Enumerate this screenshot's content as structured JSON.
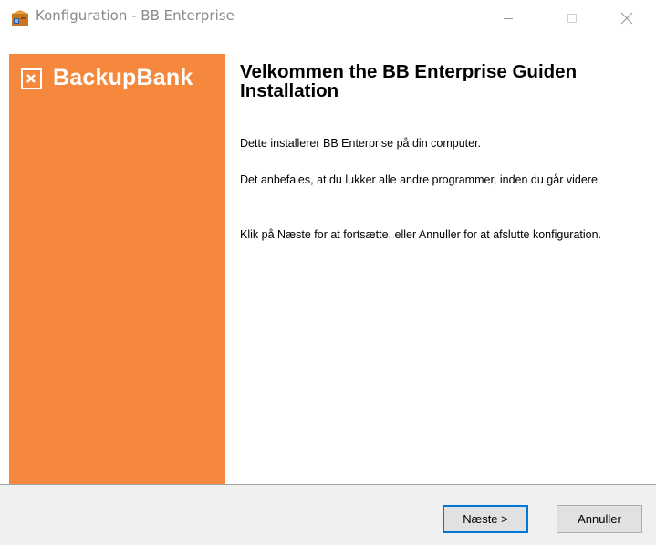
{
  "window": {
    "title": "Konfiguration - BB Enterprise",
    "app_icon": "installer-box-icon",
    "controls": [
      "minimize-icon",
      "maximize-icon",
      "close-icon"
    ]
  },
  "sidebar": {
    "logo_text": "BackupBank",
    "logo_icon": "backupbank-logo-icon",
    "color": "#f5883c"
  },
  "main": {
    "heading": "Velkommen the BB Enterprise Guiden Installation",
    "paragraphs": [
      "Dette installerer BB Enterprise på din computer.",
      "Det anbefales, at du lukker alle andre programmer, inden du går videre.",
      "Klik på Næste for at fortsætte, eller Annuller for at afslutte konfiguration."
    ]
  },
  "footer": {
    "next_label": "Næste >",
    "cancel_label": "Annuller"
  },
  "colors": {
    "accent": "#0078d7",
    "footer_bg": "#f0f0f0"
  }
}
